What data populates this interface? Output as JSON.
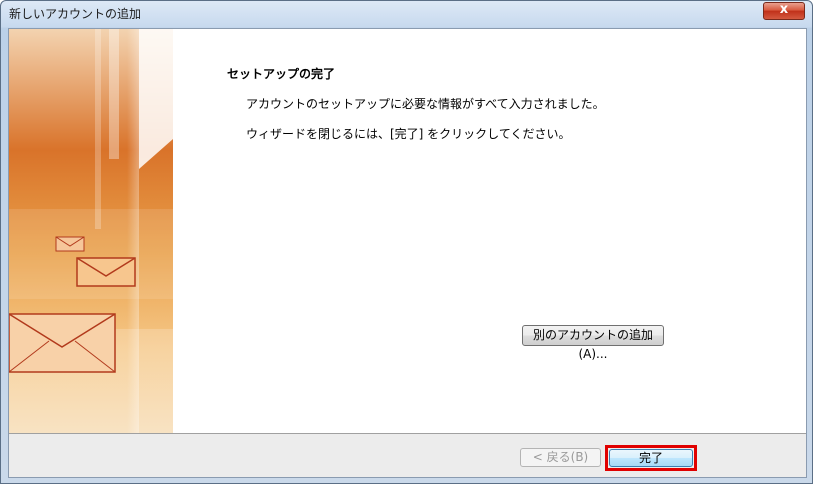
{
  "window": {
    "title": "新しいアカウントの追加",
    "close_label": "x"
  },
  "content": {
    "heading": "セットアップの完了",
    "message_1": "アカウントのセットアップに必要な情報がすべて入力されました。",
    "message_2": "ウィザードを閉じるには、[完了] をクリックしてください。"
  },
  "buttons": {
    "add_another_account": "別のアカウントの追加(A)...",
    "back": "< 戻る(B)",
    "finish": "完了"
  },
  "colors": {
    "highlight": "#e00000",
    "art_orange": "#e58a2c"
  }
}
